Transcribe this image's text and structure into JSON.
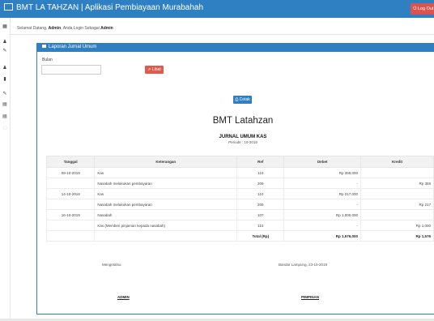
{
  "app": {
    "title": "BMT LA TAHZAN | Aplikasi Pembiayaan Murabahah",
    "logout_label": "Log Out",
    "accent_color": "#2f80c2",
    "danger_color": "#e05a4f"
  },
  "welcome": {
    "prefix": "Selamat Datang,",
    "user": "Admin",
    "mid": ", Anda Login Sebagai",
    "role": "Admin"
  },
  "sidebar": {
    "icons": [
      "dashboard-icon",
      "user-icon",
      "edit-icon",
      "user-icon",
      "book-icon",
      "edit-icon",
      "table-icon",
      "table-icon",
      "info-icon"
    ]
  },
  "panel": {
    "title": "Laporan Jurnal Umum",
    "bulan_label": "Bulan",
    "bulan_value": "",
    "lihat_label": "Lihat",
    "cetak_label": "Cetak"
  },
  "report": {
    "org": "BMT Latahzan",
    "title": "JURNAL UMUM KAS",
    "period": "Periode : 10-2019",
    "columns": [
      "Tanggal",
      "Keterangan",
      "Ref",
      "Debet",
      "Kredit"
    ],
    "rows": [
      {
        "tanggal": "09-10-2019",
        "keterangan": "Kas",
        "ref": "110",
        "debet": "Rp 359,000",
        "kredit": ""
      },
      {
        "tanggal": "",
        "keterangan": "Nasabah melakukan pembayaran",
        "ref": "209",
        "debet": "-",
        "kredit": "Rp 359"
      },
      {
        "tanggal": "14-10-2019",
        "keterangan": "Kas",
        "ref": "110",
        "debet": "Rp 217,000",
        "kredit": ""
      },
      {
        "tanggal": "",
        "keterangan": "Nasabah melakukan pembayaran",
        "ref": "209",
        "debet": "-",
        "kredit": "Rp 217"
      },
      {
        "tanggal": "16-10-2019",
        "keterangan": "Nasabah",
        "ref": "107",
        "debet": "Rp 1,000,000",
        "kredit": ""
      },
      {
        "tanggal": "",
        "keterangan": "Kas (Memberi pinjaman kepada nasabah)",
        "ref": "110",
        "debet": "-",
        "kredit": "Rp 1,000"
      }
    ],
    "total": {
      "label": "Total (Rp)",
      "debet": "Rp 1,576,000",
      "kredit": "Rp 1,576"
    },
    "acknowledge": "Mengetahui",
    "place_date": "Bandar Lampung, 23-10-2019",
    "sign_left": "ADMIN",
    "sign_right": "PIMPINAN"
  }
}
